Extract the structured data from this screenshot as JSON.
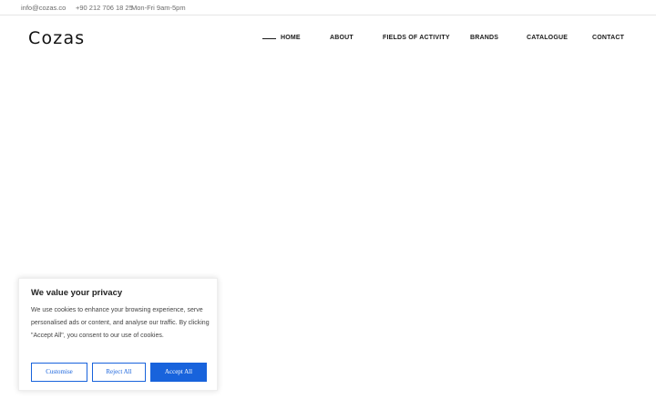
{
  "topbar": {
    "email": "info@cozas.co",
    "phone": "+90 212 706 18 25",
    "hours": "Mon-Fri 9am-5pm"
  },
  "header": {
    "logo": "Cozas",
    "nav": [
      {
        "label": "HOME",
        "active": true
      },
      {
        "label": "ABOUT"
      },
      {
        "label": "FIELDS OF ACTIVITY"
      },
      {
        "label": "BRANDS"
      },
      {
        "label": "CATALOGUE"
      },
      {
        "label": "CONTACT"
      }
    ]
  },
  "cookie_banner": {
    "title": "We value your privacy",
    "text": "We use cookies to enhance your browsing experience, serve personalised ads or content, and analyse our traffic. By clicking \"Accept All\", you consent to our use of cookies.",
    "buttons": {
      "customise": "Customise",
      "reject": "Reject All",
      "accept": "Accept All"
    },
    "accent_color": "#1863dc"
  }
}
